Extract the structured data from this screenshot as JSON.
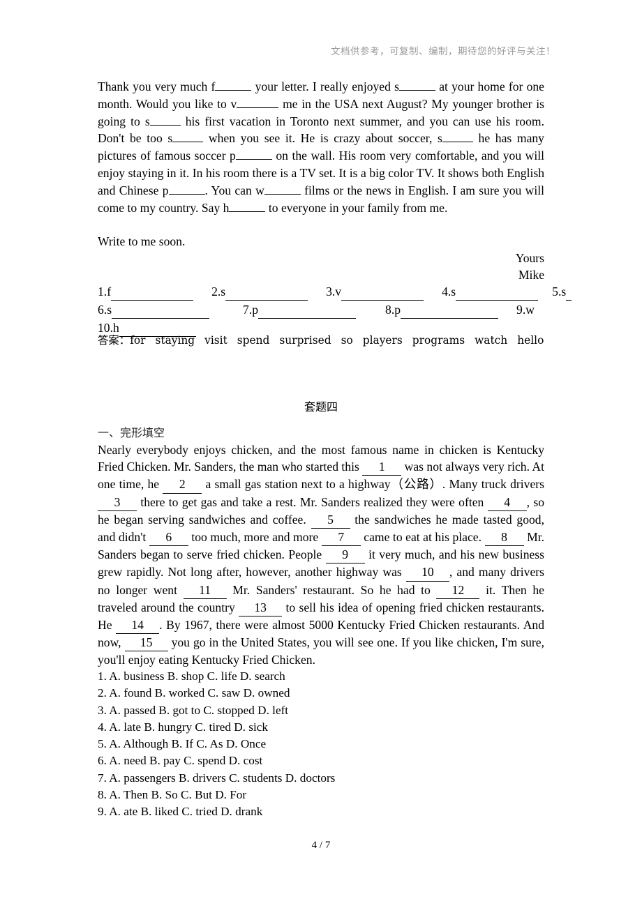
{
  "header": {
    "watermark": "文档供参考，可复制、编制，期待您的好评与关注！"
  },
  "letter": {
    "p1_a": "Thank you very much f",
    "p1_b": "your letter. I really enjoyed s",
    "p1_c": "at your home for one month. Would you like to v",
    "p1_d": "me in the USA next August? My younger brother is going to s",
    "p1_e": "his first vacation in Toronto next summer, and you can use his room. Don't be too s",
    "p1_f": "when you see it. He is crazy about soccer, s",
    "p1_g": "he has many pictures of famous soccer p",
    "p1_h": "on the wall. His room very comfortable, and you will enjoy staying in it. In his room there is a TV set. It is a big color TV. It shows both English and Chinese p",
    "p1_i": ". You can w",
    "p1_j": "films or the news in English. I am sure you will come to my country. Say h",
    "p1_k": "to everyone in your family from me.",
    "p2": "Write to me soon.",
    "sign_yours": "Yours",
    "sign_name": "Mike"
  },
  "blank_answers": {
    "row1": [
      {
        "label": "1.f",
        "width": 118
      },
      {
        "label": "2.s",
        "width": 118
      },
      {
        "label": "3.v",
        "width": 118
      },
      {
        "label": "4.s",
        "width": 118
      },
      {
        "label": "5.s",
        "width": 8
      }
    ],
    "row2": [
      {
        "label": "6.s",
        "width": 140
      },
      {
        "label": "7.p",
        "width": 140
      },
      {
        "label": "8.p",
        "width": 140
      },
      {
        "label": "9.w",
        "width": 0
      }
    ],
    "row3": [
      {
        "label": "10.h",
        "width": 110
      }
    ],
    "key_label": "答案：",
    "key_words": [
      "for",
      "staying",
      "visit",
      "spend",
      "surprised",
      "so",
      "players",
      "programs",
      "watch",
      "hello"
    ]
  },
  "section": {
    "title": "套题四",
    "subheading": "一、完形填空"
  },
  "cloze": {
    "t1": "Nearly everybody enjoys chicken, and the most famous name in chicken is Kentucky Fried Chicken. Mr. Sanders, the man who started this",
    "n1": "1",
    "t2": "was not always very rich. At one time, he",
    "n2": "2",
    "t3": "a small gas station next to a highway（公路）. Many truck drivers",
    "n3": "3",
    "t4": "there to get gas and take a rest. Mr. Sanders realized they were often",
    "n4": "4",
    "t5": ", so he began serving sandwiches and coffee.",
    "n5": "5",
    "t6": "the sandwiches he made tasted good, and didn't",
    "n6": "6",
    "t7": "too much, more and more",
    "n7": "7",
    "t8": "came to eat at his place.",
    "n8": "8",
    "t9": "Mr. Sanders began to serve fried chicken. People",
    "n9": "9",
    "t10": "it very much, and his new business grew rapidly. Not long after, however, another highway was",
    "n10": "10",
    "t11": ", and many drivers no longer went",
    "n11": "11",
    "t12": "Mr. Sanders' restaurant. So he had to",
    "n12": "12",
    "t13": "it. Then he traveled around the country",
    "n13": "13",
    "t14": "to sell his idea of opening fried chicken restaurants. He",
    "n14": "14",
    "t15": ". By 1967, there were almost 5000 Kentucky Fried Chicken restaurants. And now,",
    "n15": "15",
    "t16": "you go in the United States, you will see one. If you like chicken, I'm sure, you'll enjoy eating Kentucky Fried Chicken."
  },
  "choices": [
    "1. A. business B. shop C. life D. search",
    "2. A. found B. worked C. saw D. owned",
    "3. A. passed B. got to C. stopped D. left",
    "4. A. late B. hungry C. tired D. sick",
    "5. A. Although B. If C. As D. Once",
    "6. A. need B. pay C. spend D. cost",
    "7. A. passengers B. drivers C. students D. doctors",
    "8. A. Then B. So C. But D. For",
    "9. A. ate B. liked C. tried D. drank"
  ],
  "footer": {
    "page": "4 / 7"
  }
}
